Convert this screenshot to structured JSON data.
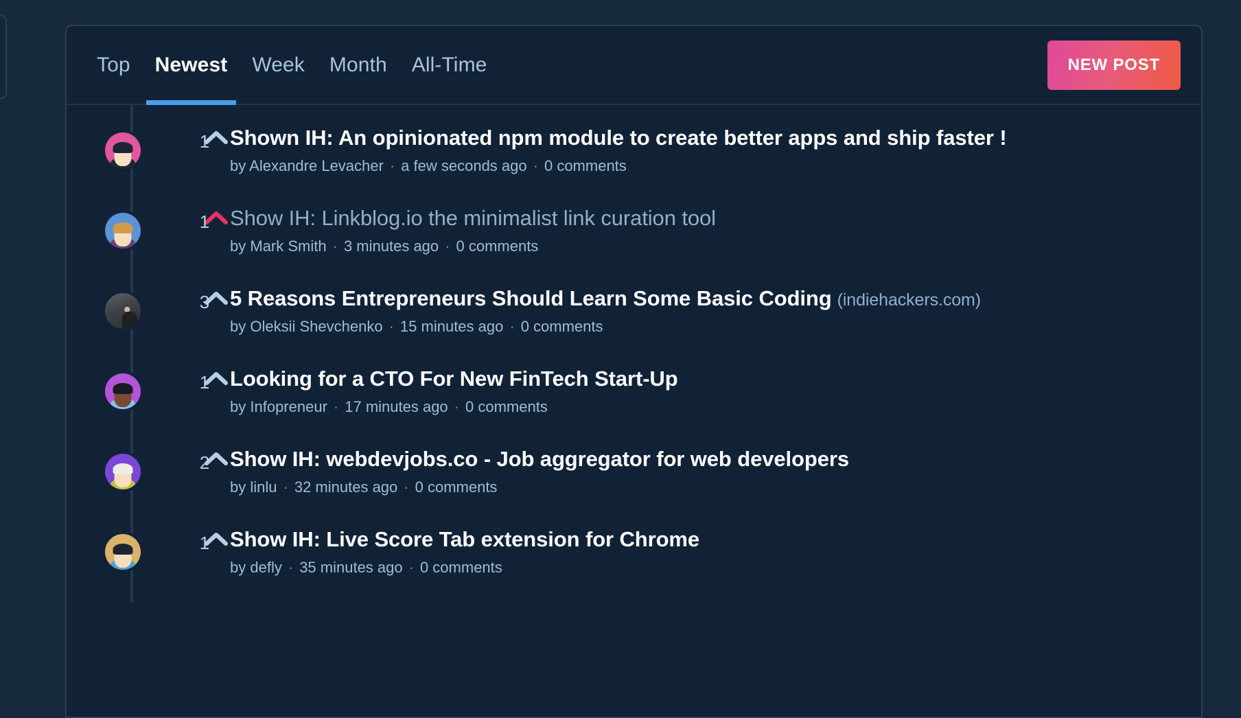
{
  "colors": {
    "page_bg": "#16293d",
    "card_bg": "#112237",
    "card_border": "#2b4055",
    "active_tab_underline": "#4a9de8",
    "arrow_default": "#b9cee3",
    "arrow_voted": "#e8315f",
    "title_default": "#ffffff",
    "title_visited": "#93aec9",
    "meta": "#9fbcd6",
    "newpost_gradient_start": "#e0499a",
    "newpost_gradient_end": "#ef5a43"
  },
  "tabbar": {
    "tabs": [
      {
        "label": "Top",
        "active": false
      },
      {
        "label": "Newest",
        "active": true
      },
      {
        "label": "Week",
        "active": false
      },
      {
        "label": "Month",
        "active": false
      },
      {
        "label": "All-Time",
        "active": false
      }
    ],
    "new_post_label": "NEW POST"
  },
  "feed": {
    "posts": [
      {
        "title": "Shown IH: An opinionated npm module to create better apps and ship faster !",
        "domain": "",
        "votes": "1",
        "voted": false,
        "visited": false,
        "author": "Alexandre Levacher",
        "time": "a few seconds ago",
        "comments": "0 comments",
        "by_label": "by",
        "avatar": {
          "name": "avatar-alexandre-levacher",
          "type": "cartoon",
          "bg": "#e0569f",
          "hair": "#1d2433",
          "skin": "#f6e0c0",
          "body": "#1f2635"
        }
      },
      {
        "title": "Show IH: Linkblog.io the minimalist link curation tool",
        "domain": "",
        "votes": "1",
        "voted": true,
        "visited": true,
        "author": "Mark Smith",
        "time": "3 minutes ago",
        "comments": "0 comments",
        "by_label": "by",
        "avatar": {
          "name": "avatar-mark-smith",
          "type": "cartoon",
          "bg": "#5b94d6",
          "hair": "#d29a49",
          "skin": "#f6dfc0",
          "body": "#6a3d7a"
        }
      },
      {
        "title": "5 Reasons Entrepreneurs Should Learn Some Basic Coding",
        "domain": "(indiehackers.com)",
        "votes": "3",
        "voted": false,
        "visited": false,
        "author": "Oleksii Shevchenko",
        "time": "15 minutes ago",
        "comments": "0 comments",
        "by_label": "by",
        "avatar": {
          "name": "avatar-oleksii-shevchenko",
          "type": "photo",
          "bg": "#3e4247",
          "hair": "#1d2024",
          "skin": "#d9b79a",
          "body": "#1d2024"
        }
      },
      {
        "title": "Looking for a CTO For New FinTech Start-Up",
        "domain": "",
        "votes": "1",
        "voted": false,
        "visited": false,
        "author": "Infopreneur",
        "time": "17 minutes ago",
        "comments": "0 comments",
        "by_label": "by",
        "avatar": {
          "name": "avatar-infopreneur",
          "type": "cartoon",
          "bg": "#b455d8",
          "hair": "#1a1a22",
          "skin": "#7a4a33",
          "body": "#7fc7e8"
        }
      },
      {
        "title": "Show IH: webdevjobs.co - Job aggregator for web developers",
        "domain": "",
        "votes": "2",
        "voted": false,
        "visited": false,
        "author": "linlu",
        "time": "32 minutes ago",
        "comments": "0 comments",
        "by_label": "by",
        "avatar": {
          "name": "avatar-linlu",
          "type": "cartoon",
          "bg": "#7b47d6",
          "hair": "#f0ece4",
          "skin": "#f6dfc0",
          "body": "#c9c23a"
        }
      },
      {
        "title": "Show IH: Live Score Tab extension for Chrome",
        "domain": "",
        "votes": "1",
        "voted": false,
        "visited": false,
        "author": "defly",
        "time": "35 minutes ago",
        "comments": "0 comments",
        "by_label": "by",
        "avatar": {
          "name": "avatar-defly",
          "type": "cartoon",
          "bg": "#d9b36a",
          "hair": "#1d2433",
          "skin": "#f6dfc0",
          "body": "#4fa3cc"
        }
      }
    ]
  }
}
